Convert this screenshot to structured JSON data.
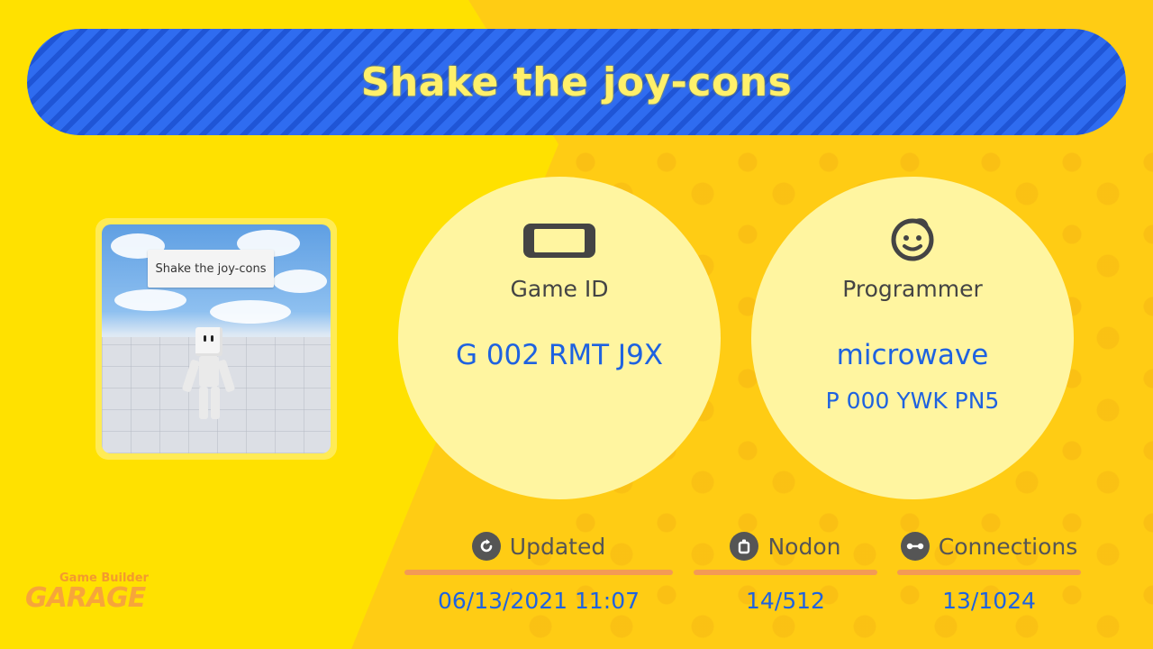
{
  "title": "Shake the joy-cons",
  "thumbnail": {
    "sign_text": "Shake the joy-cons"
  },
  "game_id": {
    "icon": "switch-console-icon",
    "label": "Game ID",
    "value": "G 002 RMT J9X"
  },
  "programmer": {
    "icon": "smiley-face-icon",
    "label": "Programmer",
    "name": "microwave",
    "id": "P 000 YWK PN5"
  },
  "stats": {
    "updated": {
      "icon": "refresh-icon",
      "label": "Updated",
      "value": "06/13/2021 11:07"
    },
    "nodon": {
      "icon": "nodon-icon",
      "label": "Nodon",
      "value": "14/512"
    },
    "connections": {
      "icon": "connection-icon",
      "label": "Connections",
      "value": "13/1024"
    }
  },
  "logo": {
    "line1": "Game Builder",
    "line2": "GARAGE"
  },
  "colors": {
    "background_yellow": "#FFE100",
    "title_blue": "#2E6BEF",
    "title_text": "#FFF06A",
    "value_blue": "#1E62E0",
    "accent_orange": "#F39A55"
  }
}
